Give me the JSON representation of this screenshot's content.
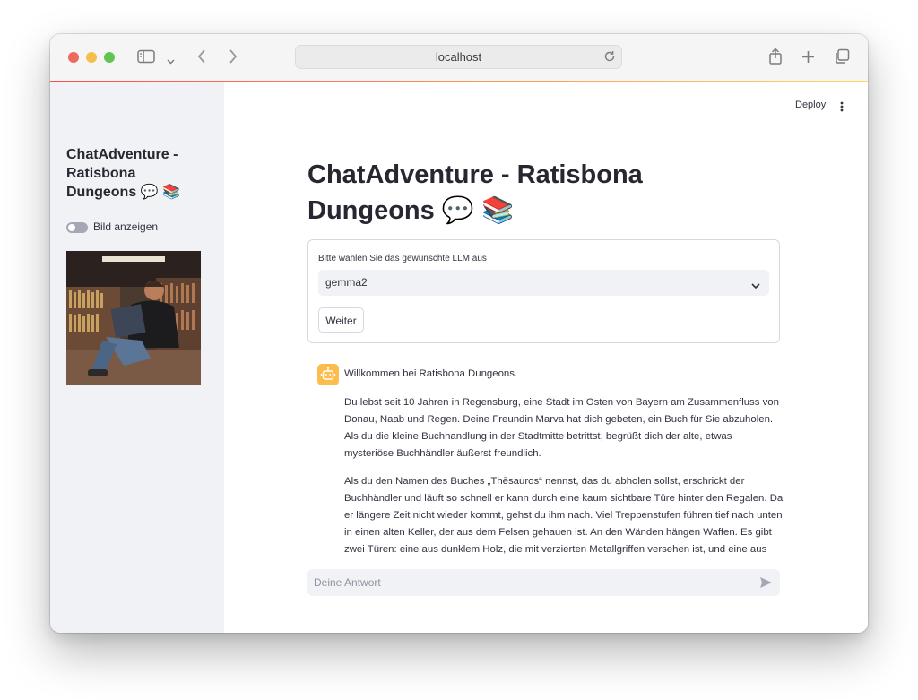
{
  "browser": {
    "url": "localhost"
  },
  "sidebar": {
    "title": "ChatAdventure - Ratisbona Dungeons 💬 📚",
    "toggle_label": "Bild anzeigen",
    "toggle_on": false
  },
  "header": {
    "deploy_label": "Deploy"
  },
  "main": {
    "title": "ChatAdventure - Ratisbona Dungeons 💬 📚",
    "form": {
      "select_label": "Bitte wählen Sie das gewünschte LLM aus",
      "select_value": "gemma2",
      "button_label": "Weiter"
    },
    "message": {
      "greeting": "Willkommen bei Ratisbona Dungeons.",
      "para1": "Du lebst seit 10 Jahren in Regensburg, eine Stadt im Osten von Bayern am Zusammenfluss von Donau, Naab und Regen. Deine Freundin Marva hat dich gebeten, ein Buch für Sie abzuholen. Als du die kleine Buchhandlung in der Stadtmitte betrittst, begrüßt dich der alte, etwas mysteriöse Buchhändler äußerst freundlich.",
      "para2": "Als du den Namen des Buches „Thēsauros“ nennst, das du abholen sollst, erschrickt der Buchhändler und läuft so schnell er kann durch eine kaum sichtbare Türe hinter den Regalen. Da er längere Zeit nicht wieder kommt, gehst du ihm nach. Viel Treppenstufen führen tief nach unten in einen alten Keller, der aus dem Felsen gehauen ist. An den Wänden hängen Waffen. Es gibt zwei Türen: eine aus dunklem Holz, die mit verzierten Metallgriffen versehen ist, und eine aus grobem"
    },
    "chat_input": {
      "placeholder": "Deine Antwort"
    }
  },
  "colors": {
    "accent_start": "#ff4b4b",
    "accent_end": "#fdd862",
    "avatar": "#fdbc4b",
    "sidebar_bg": "#f0f2f6"
  }
}
